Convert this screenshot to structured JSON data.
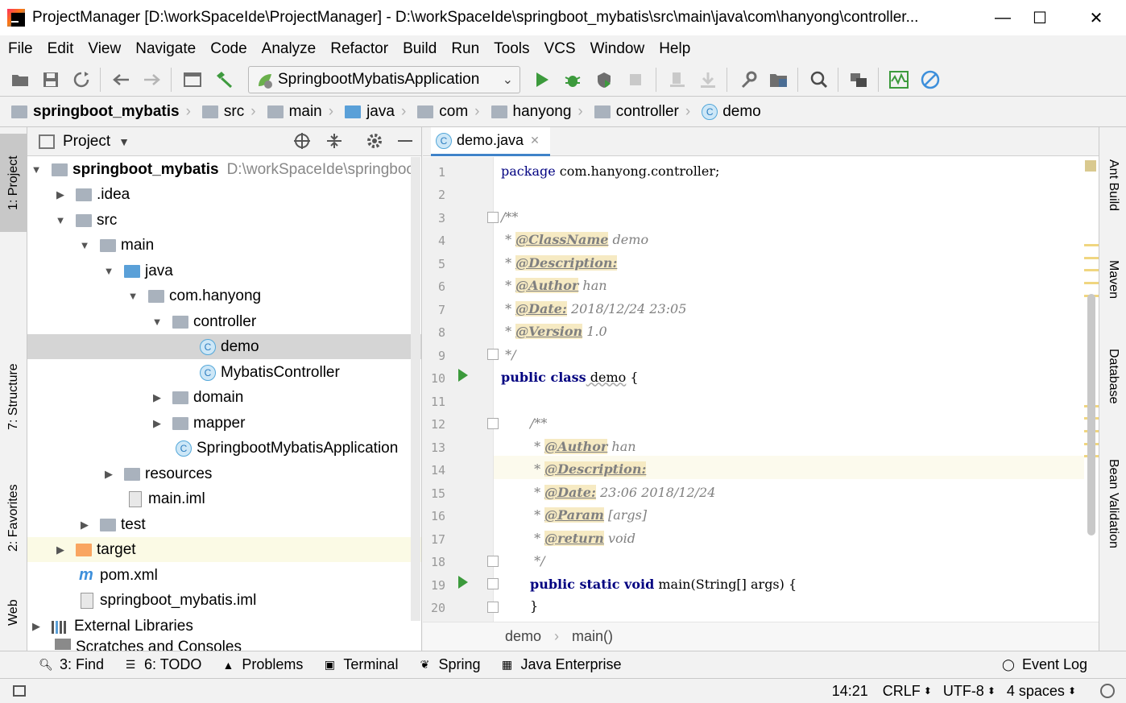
{
  "window": {
    "title": "ProjectManager [D:\\workSpaceIde\\ProjectManager] - D:\\workSpaceIde\\springboot_mybatis\\src\\main\\java\\com\\hanyong\\controller...",
    "minimize": "—",
    "maximize": "☐",
    "close": "✕"
  },
  "menu": [
    "File",
    "Edit",
    "View",
    "Navigate",
    "Code",
    "Analyze",
    "Refactor",
    "Build",
    "Run",
    "Tools",
    "VCS",
    "Window",
    "Help"
  ],
  "toolbar": {
    "run_config": "SpringbootMybatisApplication"
  },
  "breadcrumbs": [
    "springboot_mybatis",
    "src",
    "main",
    "java",
    "com",
    "hanyong",
    "controller",
    "demo"
  ],
  "left_tabs": {
    "project": "1: Project",
    "structure": "7: Structure",
    "favorites": "2: Favorites",
    "web": "Web"
  },
  "right_tabs": {
    "ant": "Ant Build",
    "maven": "Maven",
    "database": "Database",
    "bean": "Bean Validation"
  },
  "project_panel": {
    "title": "Project",
    "tree": [
      {
        "label": "springboot_mybatis",
        "path": "D:\\workSpaceIde\\springboo"
      },
      {
        "label": ".idea"
      },
      {
        "label": "src"
      },
      {
        "label": "main"
      },
      {
        "label": "java"
      },
      {
        "label": "com.hanyong"
      },
      {
        "label": "controller"
      },
      {
        "label": "demo"
      },
      {
        "label": "MybatisController"
      },
      {
        "label": "domain"
      },
      {
        "label": "mapper"
      },
      {
        "label": "SpringbootMybatisApplication"
      },
      {
        "label": "resources"
      },
      {
        "label": "main.iml"
      },
      {
        "label": "test"
      },
      {
        "label": "target"
      },
      {
        "label": "pom.xml"
      },
      {
        "label": "springboot_mybatis.iml"
      },
      {
        "label": "External Libraries"
      },
      {
        "label": "Scratches and Consoles"
      }
    ]
  },
  "editor": {
    "tab": "demo.java",
    "lines": [
      "1",
      "2",
      "3",
      "4",
      "5",
      "6",
      "7",
      "8",
      "9",
      "10",
      "11",
      "12",
      "13",
      "14",
      "15",
      "16",
      "17",
      "18",
      "19",
      "20"
    ],
    "code": {
      "l1_kw": "package",
      "l1_rest": " com.hanyong.controller;",
      "l3": "/**",
      "l4_pre": " * ",
      "l4_tag": "@ClassName",
      "l4_val": " demo",
      "l5_tag": "@Description:",
      "l6_tag": "@Author",
      "l6_val": " han",
      "l7_tag": "@Date:",
      "l7_val": " 2018/12/24 23:05",
      "l8_tag": "@Version",
      "l8_val": " 1.0",
      "l9": " */",
      "l10_kw": "public class",
      "l10_name": " demo",
      "l10_rest": " {",
      "l12": "/**",
      "l13_tag": "@Author",
      "l13_val": " han",
      "l14_tag": "@Description:",
      "l15_tag": "@Date:",
      "l15_val": " 23:06 2018/12/24",
      "l16_tag": "@Param",
      "l16_val": " [args]",
      "l17_tag": "@return",
      "l17_val": " void",
      "l18": " */",
      "l19_kw": "public static void",
      "l19_rest": " main(String[] args) {",
      "l20": "}"
    },
    "breadcrumb": [
      "demo",
      "main()"
    ]
  },
  "bottom_tools": {
    "find": "3: Find",
    "todo": "6: TODO",
    "problems": "Problems",
    "terminal": "Terminal",
    "spring": "Spring",
    "java_ee": "Java Enterprise",
    "event_log": "Event Log"
  },
  "status": {
    "position": "14:21",
    "line_sep": "CRLF",
    "encoding": "UTF-8",
    "indent": "4 spaces"
  }
}
